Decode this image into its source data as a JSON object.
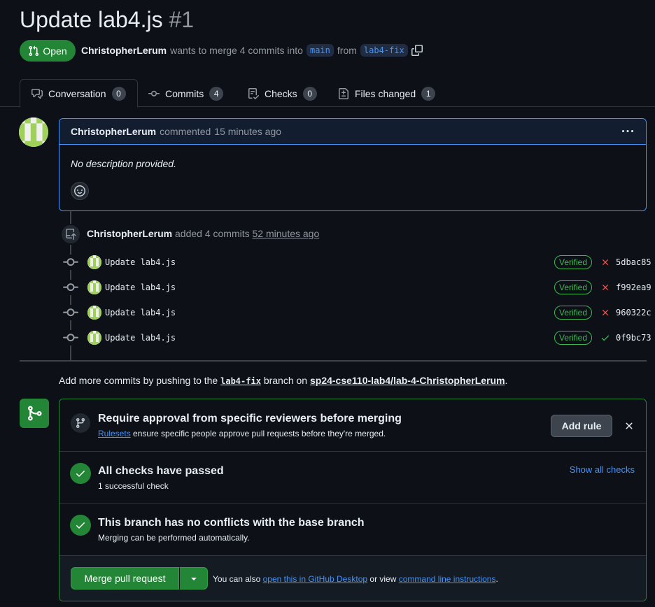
{
  "header": {
    "title": "Update lab4.js",
    "number": "#1",
    "state": "Open",
    "author": "ChristopherLerum",
    "meta_text": "wants to merge 4 commits into",
    "base_branch": "main",
    "from_text": "from",
    "head_branch": "lab4-fix"
  },
  "tabs": [
    {
      "label": "Conversation",
      "count": "0",
      "icon": "comment-discussion-icon"
    },
    {
      "label": "Commits",
      "count": "4",
      "icon": "git-commit-icon"
    },
    {
      "label": "Checks",
      "count": "0",
      "icon": "checklist-icon"
    },
    {
      "label": "Files changed",
      "count": "1",
      "icon": "file-diff-icon"
    }
  ],
  "comment": {
    "author": "ChristopherLerum",
    "action": "commented",
    "time": "15 minutes ago",
    "body": "No description provided."
  },
  "commits_event": {
    "author": "ChristopherLerum",
    "action": "added 4 commits",
    "time": "52 minutes ago"
  },
  "commits": [
    {
      "message": "Update lab4.js",
      "badge": "Verified",
      "status": "fail",
      "sha": "5dbac85"
    },
    {
      "message": "Update lab4.js",
      "badge": "Verified",
      "status": "fail",
      "sha": "f992ea9"
    },
    {
      "message": "Update lab4.js",
      "badge": "Verified",
      "status": "fail",
      "sha": "960322c"
    },
    {
      "message": "Update lab4.js",
      "badge": "Verified",
      "status": "pass",
      "sha": "0f9bc73"
    }
  ],
  "push_hint": {
    "prefix": "Add more commits by pushing to the",
    "branch": "lab4-fix",
    "middle": "branch on",
    "repo": "sp24-cse110-lab4/lab-4-ChristopherLerum",
    "suffix": "."
  },
  "merge": {
    "rule": {
      "title": "Require approval from specific reviewers before merging",
      "link": "Rulesets",
      "desc": "ensure specific people approve pull requests before they're merged.",
      "button": "Add rule"
    },
    "checks": {
      "title": "All checks have passed",
      "desc": "1 successful check",
      "link": "Show all checks"
    },
    "conflicts": {
      "title": "This branch has no conflicts with the base branch",
      "desc": "Merging can be performed automatically."
    },
    "button": "Merge pull request",
    "footer": {
      "prefix": "You can also",
      "link1": "open this in GitHub Desktop",
      "middle": "or view",
      "link2": "command line instructions",
      "suffix": "."
    }
  },
  "colors": {
    "background": "#0d1117",
    "accent": "#4493f8",
    "success": "#238636",
    "danger": "#f85149"
  }
}
